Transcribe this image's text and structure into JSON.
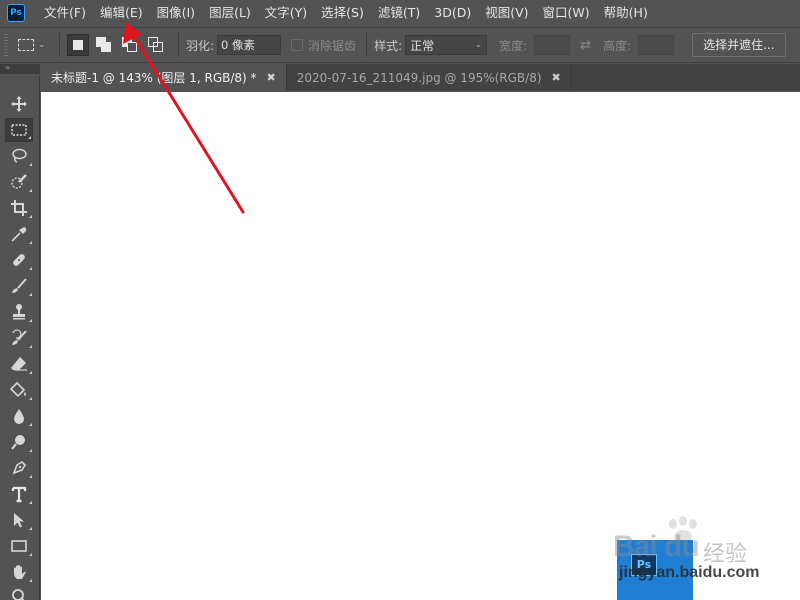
{
  "app": {
    "logo_text": "Ps"
  },
  "menu": [
    {
      "label": "文件(F)"
    },
    {
      "label": "编辑(E)"
    },
    {
      "label": "图像(I)"
    },
    {
      "label": "图层(L)"
    },
    {
      "label": "文字(Y)"
    },
    {
      "label": "选择(S)"
    },
    {
      "label": "滤镜(T)"
    },
    {
      "label": "3D(D)"
    },
    {
      "label": "视图(V)"
    },
    {
      "label": "窗口(W)"
    },
    {
      "label": "帮助(H)"
    }
  ],
  "options": {
    "feather_label": "羽化:",
    "feather_value": "0 像素",
    "antialias_label": "消除锯齿",
    "style_label": "样式:",
    "style_value": "正常",
    "width_label": "宽度:",
    "height_label": "高度:",
    "select_mask_label": "选择并遮住..."
  },
  "tabs": [
    {
      "label": "未标题-1 @ 143% (图层 1, RGB/8) *",
      "active": true
    },
    {
      "label": "2020-07-16_211049.jpg @ 195%(RGB/8)",
      "active": false
    }
  ],
  "tools": [
    "move-tool",
    "rectangular-marquee-tool",
    "lasso-tool",
    "quick-selection-tool",
    "crop-tool",
    "eyedropper-tool",
    "spot-healing-brush-tool",
    "brush-tool",
    "clone-stamp-tool",
    "history-brush-tool",
    "eraser-tool",
    "paint-bucket-tool",
    "blur-tool",
    "dodge-tool",
    "pen-tool",
    "type-tool",
    "path-selection-tool",
    "rectangle-tool",
    "hand-tool",
    "zoom-tool"
  ],
  "watermark": {
    "brand": "Bai du",
    "cn": "经验",
    "url": "jingyan.baidu.com",
    "logo_text": "Ps"
  },
  "colors": {
    "chrome": "#535353",
    "canvas": "#ffffff",
    "arrow": "#e0141e",
    "ps_blue": "#31a8ff"
  }
}
